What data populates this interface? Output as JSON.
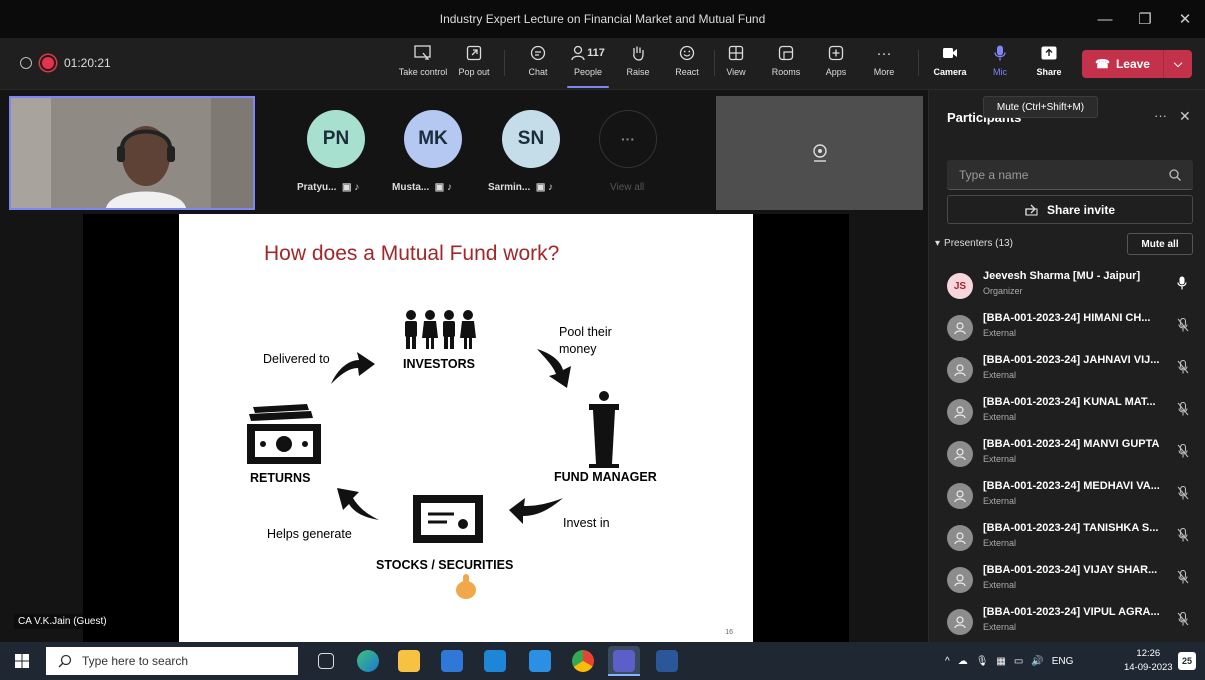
{
  "window": {
    "title": "Industry Expert Lecture on Financial Market and Mutual Fund",
    "minimize": "—",
    "restore": "❐",
    "close": "✕"
  },
  "meeting": {
    "timer": "01:20:21"
  },
  "toolbar": {
    "take_control": "Take control",
    "pop_out": "Pop out",
    "chat": "Chat",
    "people": "People",
    "people_count": "117",
    "raise": "Raise",
    "react": "React",
    "view": "View",
    "rooms": "Rooms",
    "apps": "Apps",
    "more": "More",
    "camera": "Camera",
    "mic": "Mic",
    "share": "Share",
    "leave": "Leave"
  },
  "tooltip": "Mute (Ctrl+Shift+M)",
  "gallery": [
    {
      "initials": "PN",
      "name": "Pratyu...",
      "color": "#a8e0cf"
    },
    {
      "initials": "MK",
      "name": "Musta...",
      "color": "#b5c8f2"
    },
    {
      "initials": "SN",
      "name": "Sarmin...",
      "color": "#c5dde8"
    }
  ],
  "view_all": "View all",
  "guest_label": "CA V.K.Jain (Guest)",
  "slide": {
    "title": "How does a Mutual Fund work?",
    "investors": "INVESTORS",
    "pool": "Pool their",
    "money": "money",
    "delivered": "Delivered to",
    "fund_manager": "FUND MANAGER",
    "returns": "RETURNS",
    "invest_in": "Invest in",
    "helps": "Helps generate",
    "stocks": "STOCKS / SECURITIES",
    "page": "16"
  },
  "panel": {
    "title": "Participants",
    "search_placeholder": "Type a name",
    "share_invite": "Share invite",
    "presenters": "Presenters (13)",
    "mute_all": "Mute all",
    "participants": [
      {
        "initials": "JS",
        "name": "Jeevesh Sharma [MU - Jaipur]",
        "role": "Organizer"
      },
      {
        "name": "[BBA-001-2023-24] HIMANI CH...",
        "role": "External"
      },
      {
        "name": "[BBA-001-2023-24] JAHNAVI VIJ...",
        "role": "External"
      },
      {
        "name": "[BBA-001-2023-24] KUNAL MAT...",
        "role": "External"
      },
      {
        "name": "[BBA-001-2023-24] MANVI GUPTA",
        "role": "External"
      },
      {
        "name": "[BBA-001-2023-24] MEDHAVI VA...",
        "role": "External"
      },
      {
        "name": "[BBA-001-2023-24] TANISHKA S...",
        "role": "External"
      },
      {
        "name": "[BBA-001-2023-24] VIJAY SHAR...",
        "role": "External"
      },
      {
        "name": "[BBA-001-2023-24] VIPUL AGRA...",
        "role": "External"
      }
    ]
  },
  "taskbar": {
    "search_placeholder": "Type here to search",
    "lang": "ENG",
    "time": "12:26",
    "date": "14-09-2023",
    "notif": "25"
  }
}
